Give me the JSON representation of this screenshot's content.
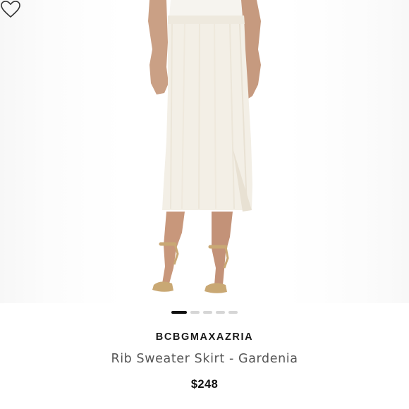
{
  "product": {
    "brand": "BCBGMAXAZRIA",
    "title": "Rib Sweater Skirt - Gardenia",
    "price": "$248"
  },
  "image": {
    "description_icon": "product-photo",
    "favorite_icon": "heart-outline-icon"
  },
  "carousel": {
    "count": 5,
    "active_index": 0
  },
  "colors": {
    "skirt": "#f3efe6",
    "skin": "#c9977c",
    "sandal": "#c9a874",
    "text_dark": "#111111",
    "text_muted": "#555555",
    "dot_inactive": "#d6d6d6",
    "dot_active": "#111111"
  }
}
